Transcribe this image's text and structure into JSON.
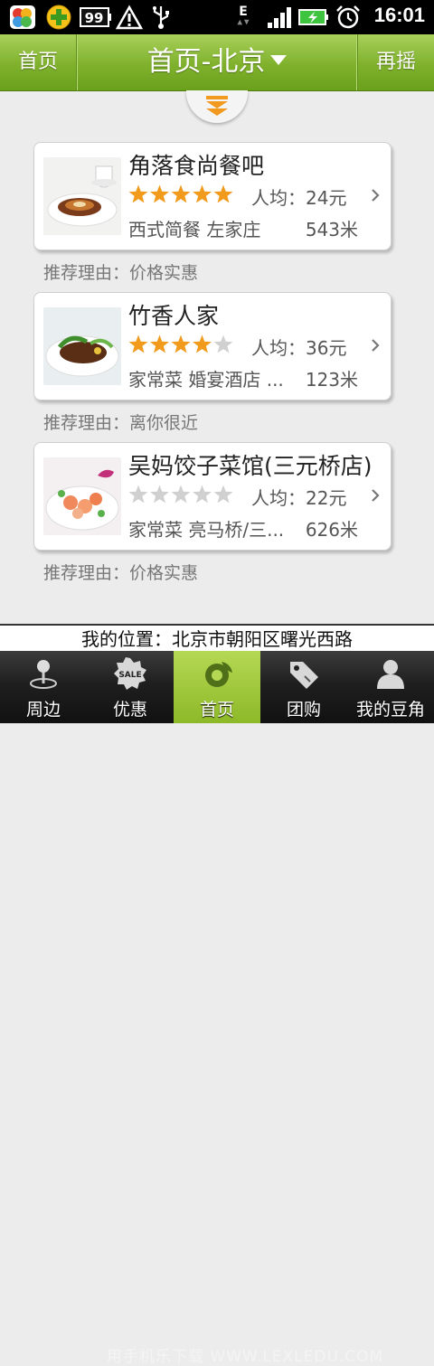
{
  "status_bar": {
    "time": "16:01",
    "battery_badge": "99",
    "network_label": "E",
    "icons": [
      "photo-app-icon",
      "add-icon",
      "battery-badge-icon",
      "warning-icon",
      "usb-icon",
      "network-e-icon",
      "signal-icon",
      "battery-charging-icon",
      "alarm-icon"
    ]
  },
  "header": {
    "left_button": "首页",
    "title": "首页-北京",
    "right_button": "再摇",
    "bar_color": "#7fb12c"
  },
  "restaurants": [
    {
      "name": "角落食尚餐吧",
      "rating": 5,
      "avg_price": "人均：24元",
      "category": "西式简餐 左家庄",
      "distance": "543米",
      "reason": "推荐理由：价格实惠",
      "image": "dessert-plate-thumbnail"
    },
    {
      "name": "竹香人家",
      "rating": 4,
      "avg_price": "人均：36元",
      "category": "家常菜 婚宴酒店 ...",
      "distance": "123米",
      "reason": "推荐理由：离你很近",
      "image": "steak-dish-thumbnail"
    },
    {
      "name": "吴妈饺子菜馆(三元桥店)",
      "rating": 0,
      "avg_price": "人均：22元",
      "category": "家常菜 亮马桥/三...",
      "distance": "626米",
      "reason": "推荐理由：价格实惠",
      "image": "seafood-salad-thumbnail"
    }
  ],
  "star_colors": {
    "filled": "#f19a1c",
    "empty": "#d0d0d0"
  },
  "location": {
    "text": "我的位置：北京市朝阳区曙光西路"
  },
  "tabs": [
    {
      "label": "周边",
      "icon": "map-pin-icon",
      "active": false
    },
    {
      "label": "优惠",
      "icon": "sale-tag-icon",
      "active": false
    },
    {
      "label": "首页",
      "icon": "shake-logo-icon",
      "active": true
    },
    {
      "label": "团购",
      "icon": "tag-icon",
      "active": false
    },
    {
      "label": "我的豆角",
      "icon": "user-icon",
      "active": false
    }
  ],
  "watermark": "用手机乐下载 WWW.LEXLEDU.COM"
}
